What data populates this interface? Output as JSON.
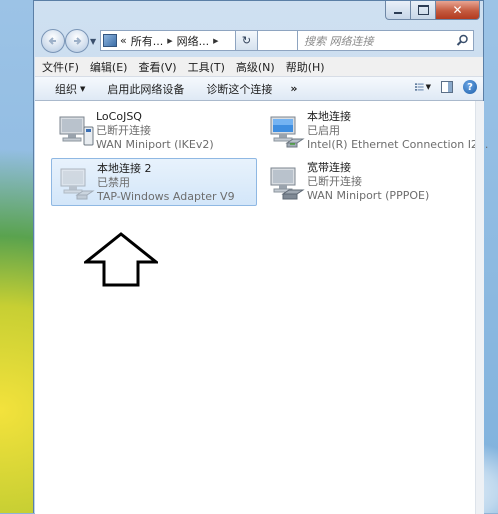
{
  "window": {
    "controls": {
      "close_glyph": "✕"
    }
  },
  "navigation": {
    "back_icon": "back-arrow-icon",
    "forward_icon": "forward-arrow-icon",
    "breadcrumb": [
      "«",
      "所有...",
      "网络...",
      ""
    ],
    "refresh_glyph": "↻",
    "search_placeholder": "搜索 网络连接"
  },
  "menubar": {
    "items": [
      "文件(F)",
      "编辑(E)",
      "查看(V)",
      "工具(T)",
      "高级(N)",
      "帮助(H)"
    ]
  },
  "commandbar": {
    "organize": "组织",
    "enable_device": "启用此网络设备",
    "diagnose": "诊断这个连接",
    "more": "»",
    "help_glyph": "?"
  },
  "connections": [
    {
      "name": "LoCoJSQ",
      "status": "已断开连接",
      "device": "WAN Miniport (IKEv2)",
      "icon": "vpn-connection-icon",
      "selected": false
    },
    {
      "name": "本地连接",
      "status": "已启用",
      "device": "Intel(R) Ethernet Connection I2...",
      "icon": "lan-connection-icon",
      "selected": false
    },
    {
      "name": "本地连接 2",
      "status": "已禁用",
      "device": "TAP-Windows Adapter V9",
      "icon": "lan-connection-disabled-icon",
      "selected": true
    },
    {
      "name": "宽带连接",
      "status": "已断开连接",
      "device": "WAN Miniport (PPPOE)",
      "icon": "broadband-connection-icon",
      "selected": false
    }
  ],
  "colors": {
    "selection_border": "#8fb8e3",
    "selection_fill": "#d3e6f9",
    "close_button": "#c45a3f"
  }
}
